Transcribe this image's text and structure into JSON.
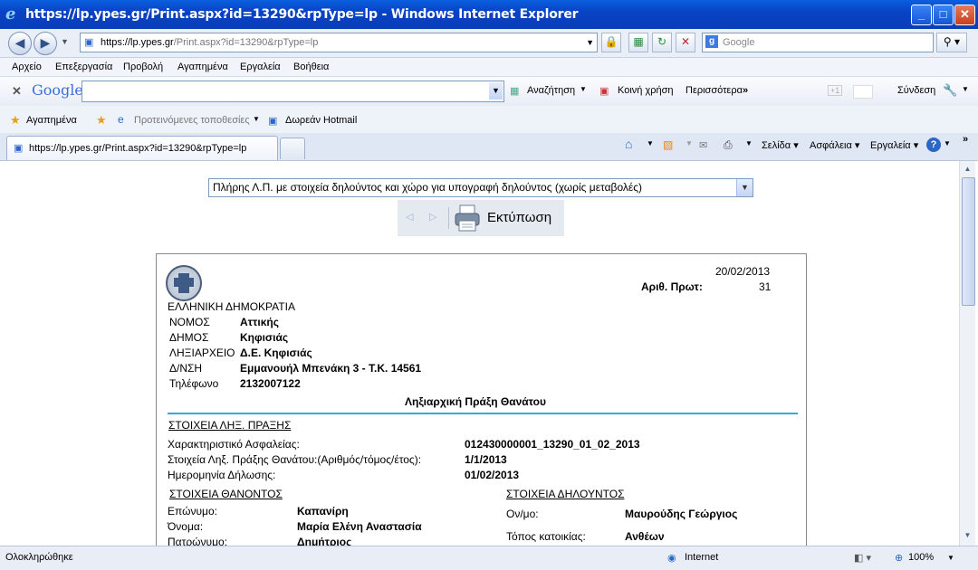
{
  "window": {
    "title": "https://lp.ypes.gr/Print.aspx?id=13290&rpType=lp - Windows Internet Explorer"
  },
  "address": {
    "host": "https://lp.ypes.gr",
    "path": "/Print.aspx?id=13290&rpType=lp",
    "search_placeholder": "Google"
  },
  "menu": [
    "Αρχείο",
    "Επεξεργασία",
    "Προβολή",
    "Αγαπημένα",
    "Εργαλεία",
    "Βοήθεια"
  ],
  "google_toolbar": {
    "logo": "Google",
    "search": "Αναζήτηση",
    "share": "Κοινή χρήση",
    "more": "Περισσότερα",
    "plus": "+1",
    "signin": "Σύνδεση"
  },
  "favorites": {
    "label": "Αγαπημένα",
    "suggested": "Προτεινόμενες τοποθεσίες",
    "hotmail": "Δωρεάν Hotmail"
  },
  "tab": {
    "label": "https://lp.ypes.gr/Print.aspx?id=13290&rpType=lp"
  },
  "commands": {
    "page": "Σελίδα",
    "safety": "Ασφάλεια",
    "tools": "Εργαλεία"
  },
  "report_select": "Πλήρης Λ.Π. με στοιχεία δηλούντος και χώρο για υπογραφή δηλούντος (χωρίς μεταβολές)",
  "print_label": "Εκτύπωση",
  "doc": {
    "date": "20/02/2013",
    "protocol_label": "Αριθ. Πρωτ:",
    "protocol_value": "31",
    "republic": "ΕΛΛΗΝΙΚΗ ΔΗΜΟΚΡΑΤΙΑ",
    "header_rows": [
      {
        "label": "ΝΟΜΟΣ",
        "value": "Αττικής"
      },
      {
        "label": "ΔΗΜΟΣ",
        "value": "Κηφισιάς"
      },
      {
        "label": "ΛΗΞΙΑΡΧΕΙΟ",
        "value": "Δ.Ε. Κηφισιάς"
      },
      {
        "label": "Δ/ΝΣΗ",
        "value": "Εμμανουήλ Μπενάκη 3 - Τ.Κ. 14561"
      },
      {
        "label": "Τηλέφωνο",
        "value": "2132007122"
      }
    ],
    "act_title": "Ληξιαρχική Πράξη Θανάτου",
    "section_act": "ΣΤΟΙΧΕΙΑ ΛΗΞ. ΠΡΑΞΗΣ",
    "act_rows": [
      {
        "label": "Χαρακτηριστικό Ασφαλείας:",
        "value": "012430000001_13290_01_02_2013"
      },
      {
        "label": "Στοιχεία Ληξ. Πράξης Θανάτου:(Αριθμός/τόμος/έτος):",
        "value": "1/1/2013"
      },
      {
        "label": "Ημερομηνία Δήλωσης:",
        "value": "01/02/2013"
      }
    ],
    "section_deceased": "ΣΤΟΙΧΕΙΑ ΘΑΝΟΝΤΟΣ",
    "deceased_rows": [
      {
        "label": "Επώνυμο:",
        "value": "Καπανίρη"
      },
      {
        "label": "Όνομα:",
        "value": "Μαρία Ελένη Αναστασία"
      },
      {
        "label": "Πατρώνυμο:",
        "value": "Δημήτριος"
      }
    ],
    "section_declarant": "ΣΤΟΙΧΕΙΑ ΔΗΛΟΥΝΤΟΣ",
    "declarant_rows": [
      {
        "label": "Ον/μο:",
        "value": "Μαυρούδης Γεώργιος"
      },
      {
        "label": "Τόπος κατοικίας:",
        "value": "Ανθέων"
      }
    ]
  },
  "status": {
    "text": "Ολοκληρώθηκε",
    "zone": "Internet",
    "zoom": "100%"
  }
}
